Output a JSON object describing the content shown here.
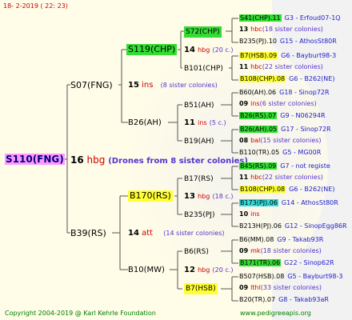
{
  "header": {
    "date": "18-  2-2019 (  22:  23)"
  },
  "footer": {
    "copyright": "Copyright 2004-2019 @ Karl Kehrle Foundation",
    "site": "www.pedigreeapis.org"
  },
  "root": {
    "label": "S110(FNG)",
    "num": "16",
    "unit": "hbg",
    "note": "(Drones from 8 sister colonies)"
  },
  "sire": {
    "label": "S07(FNG)",
    "num": "15",
    "unit": "ins",
    "note": "(8 sister colonies)"
  },
  "dam": {
    "label": "B39(RS)",
    "num": "14",
    "unit": "att",
    "note": "(14 sister colonies)"
  },
  "ss": {
    "label": "S119(CHP)",
    "num": "14",
    "unit": "hbg",
    "note": "(20 c.)"
  },
  "sd": {
    "label": "B26(AH)",
    "num": "11",
    "unit": "ins",
    "note": "(5 c.)"
  },
  "ds": {
    "label": "B170(RS)",
    "num": "13",
    "unit": "hbg",
    "note": "(18 c.)"
  },
  "dd": {
    "label": "B10(MW)",
    "num": "12",
    "unit": "hbg",
    "note": "(20 c.)"
  },
  "g3": [
    {
      "label": "S72(CHP)"
    },
    {
      "label": "B101(CHP)"
    },
    {
      "label": "B51(AH)"
    },
    {
      "label": "B19(AH)"
    },
    {
      "label": "B17(RS)"
    },
    {
      "label": "B235(PJ)"
    },
    {
      "label": "B6(RS)"
    },
    {
      "label": "B7(HSB)"
    }
  ],
  "g4": [
    {
      "label": "S41(CHP).11",
      "info": "G3 - Erfoud07-1Q"
    },
    {
      "num": "13",
      "unit": "hbc",
      "note": "(18 sister colonies)"
    },
    {
      "label": "B235(PJ).10",
      "info": "G15 - AthosSt80R"
    },
    {
      "label": "B7(HSB).09",
      "info": "G6 - Bayburt98-3"
    },
    {
      "num": "11",
      "unit": "hbc",
      "note": "(22 sister colonies)"
    },
    {
      "label": "B108(CHP).08",
      "info": "G6 - B262(NE)"
    },
    {
      "label": "B60(AH).06",
      "info": "G18 - Sinop72R"
    },
    {
      "num": "09",
      "unit": "ins",
      "note": "(6 sister colonies)"
    },
    {
      "label": "B26(RS).07",
      "info": "G9 - N06294R"
    },
    {
      "label": "B26(AH).05",
      "info": "G17 - Sinop72R"
    },
    {
      "num": "08",
      "unit": "bal",
      "note": "(15 sister colonies)"
    },
    {
      "label": "B110(TR).05",
      "info": "G5 - MG00R"
    },
    {
      "label": "B45(RS).09",
      "info": "G7 - not registe"
    },
    {
      "num": "11",
      "unit": "hbc",
      "note": "(22 sister colonies)"
    },
    {
      "label": "B108(CHP).08",
      "info": "G6 - B262(NE)"
    },
    {
      "label": "B173(PJ).06",
      "info": "G14 - AthosSt80R"
    },
    {
      "num": "10",
      "unit": "ins",
      "note": ""
    },
    {
      "label": "B213H(PJ).06",
      "info": "G12 - SinopEgg86R"
    },
    {
      "label": "B6(MM).08",
      "info": "G9 - Takab93R"
    },
    {
      "num": "09",
      "unit": "mk",
      "note": "(18 sister colonies)"
    },
    {
      "label": "B171(TR).06",
      "info": "G22 - Sinop62R"
    },
    {
      "label": "B507(HSB).08",
      "info": "G5 - Bayburt98-3"
    },
    {
      "num": "09",
      "unit": "lthl",
      "note": "(33 sister colonies)"
    },
    {
      "label": "B20(TR).07",
      "info": "G8 - Takab93aR"
    }
  ],
  "colors": {
    "lines": "#555555",
    "num": "#000000",
    "unit": "#cc0000",
    "sisters": "#5533cc",
    "info": "#2020cc",
    "root_bg": "#ff99ff",
    "yellow": "#ffff33",
    "green": "#33dd33",
    "cyan": "#33dddd",
    "copyright": "#008000",
    "date": "#cc0000"
  }
}
